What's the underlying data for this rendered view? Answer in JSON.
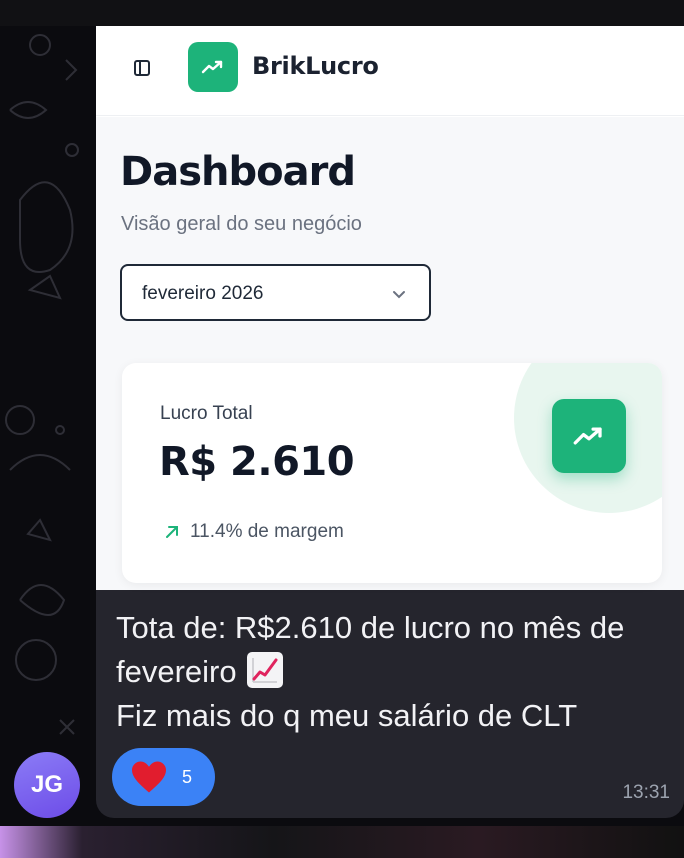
{
  "app": {
    "brand": "BrikLucro",
    "accent_color": "#1db37a",
    "icons": {
      "sidebar": "sidebar-toggle-icon",
      "logo": "trending-up-icon"
    }
  },
  "dashboard": {
    "title": "Dashboard",
    "subtitle": "Visão geral do seu negócio",
    "month_select": {
      "value": "fevereiro 2026",
      "icon": "chevron-down-icon"
    },
    "profit_card": {
      "label": "Lucro Total",
      "value": "R$ 2.610",
      "margin": "11.4% de margem",
      "icon": "trending-up-icon"
    }
  },
  "message": {
    "lines": [
      "Tota de: R$2.610 de lucro no mês de",
      "fevereiro",
      "Fiz mais do q meu salário de CLT"
    ],
    "emoji": "chart-increasing-emoji",
    "reaction": {
      "emoji": "heart",
      "count": "5"
    },
    "time": "13:31",
    "bubble_color": "#25252d"
  },
  "sender": {
    "initials": "JG"
  }
}
